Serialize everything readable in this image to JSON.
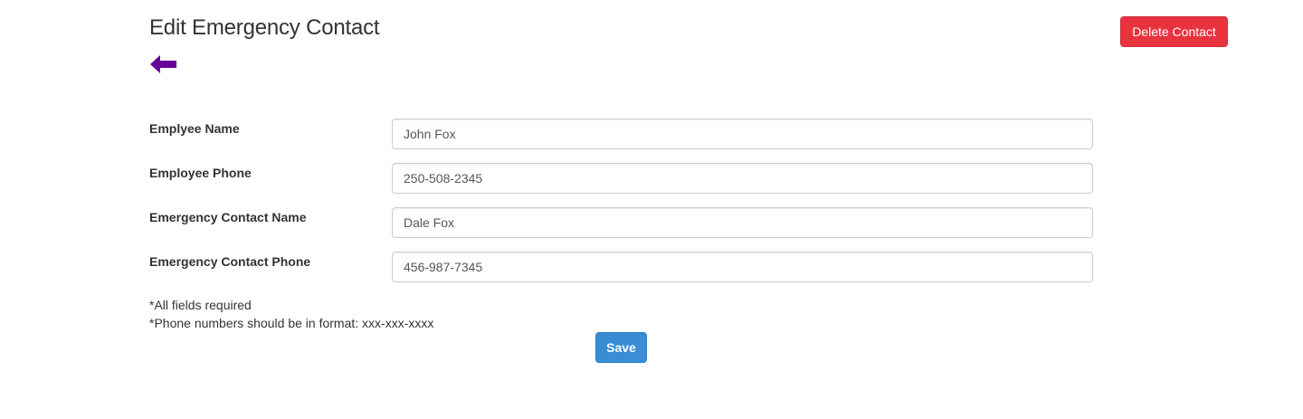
{
  "page": {
    "title": "Edit Emergency Contact"
  },
  "actions": {
    "delete_label": "Delete Contact",
    "save_label": "Save",
    "back_icon": "arrow-left-icon"
  },
  "form": {
    "fields": [
      {
        "label": "Emplyee Name",
        "value": "John Fox"
      },
      {
        "label": "Employee Phone",
        "value": "250-508-2345"
      },
      {
        "label": "Emergency Contact Name",
        "value": "Dale Fox"
      },
      {
        "label": "Emergency Contact Phone",
        "value": "456-987-7345"
      }
    ],
    "notes": [
      "*All fields required",
      "*Phone numbers should be in format: xxx-xxx-xxxx"
    ]
  },
  "colors": {
    "back_arrow": "#660099",
    "delete_button": "#e8333f",
    "save_button": "#3a8dd5"
  }
}
